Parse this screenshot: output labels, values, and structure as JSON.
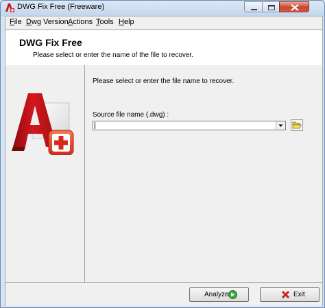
{
  "window": {
    "title": "DWG Fix Free (Freeware)",
    "icon": "dwg-app-icon",
    "controls": [
      "minimize-icon",
      "maximize-icon",
      "close-icon"
    ]
  },
  "menu": {
    "items": [
      {
        "label": "File",
        "accel": "F",
        "rest": "ile"
      },
      {
        "label": "Dwg Version",
        "accel": "D",
        "rest": "wg Version"
      },
      {
        "label": "Actions",
        "accel": "A",
        "rest": "ctions"
      },
      {
        "label": "Tools",
        "accel": "T",
        "rest": "ools"
      },
      {
        "label": "Help",
        "accel": "H",
        "rest": "elp"
      }
    ]
  },
  "header": {
    "title": "DWG Fix Free",
    "subtitle": "Please select or enter the name of the file to recover."
  },
  "main": {
    "prompt": "Please select or enter the file name to recover.",
    "source_label": "Source file name (.dwg) :",
    "source_value": "",
    "browse_icon": "folder-open-icon"
  },
  "footer": {
    "analyze_label": "Analyze",
    "analyze_icon": "arrow-right-icon",
    "exit_label": "Exit",
    "exit_icon": "x-icon"
  },
  "colors": {
    "logo_red": "#c8141b",
    "plus_badge": "#e2362a",
    "analyze_green": "#3aa635",
    "exit_red": "#c81e1e"
  }
}
